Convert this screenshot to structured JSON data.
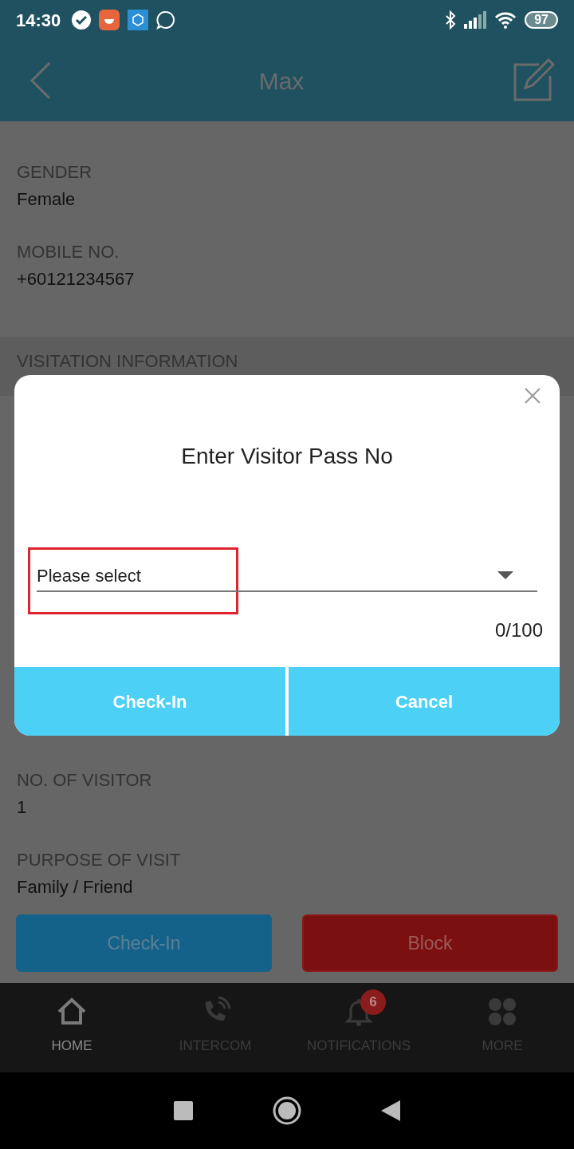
{
  "status_bar": {
    "time": "14:30",
    "battery": "97"
  },
  "header": {
    "title": "Max"
  },
  "fields": [
    {
      "label": "GENDER",
      "value": "Female"
    },
    {
      "label": "MOBILE NO.",
      "value": "+60121234567"
    }
  ],
  "section": {
    "title": "VISITATION INFORMATION"
  },
  "lower_fields": [
    {
      "label": "NO. OF VISITOR",
      "value": "1"
    },
    {
      "label": "PURPOSE OF VISIT",
      "value": "Family / Friend"
    }
  ],
  "actions": [
    {
      "label": "Check-In",
      "kind": "primary"
    },
    {
      "label": "Block",
      "kind": "danger"
    }
  ],
  "dialog": {
    "title": "Enter Visitor Pass No",
    "select": {
      "value": "Please select",
      "highlighted": true
    },
    "counter": "0/100",
    "buttons": [
      "Check-In",
      "Cancel"
    ]
  },
  "nav": [
    {
      "label": "HOME",
      "kind": "home",
      "selected": true
    },
    {
      "label": "INTERCOM",
      "kind": "phone",
      "selected": false
    },
    {
      "label": "NOTIFICATIONS",
      "kind": "bell",
      "selected": false,
      "badge": "6"
    },
    {
      "label": "MORE",
      "kind": "grid",
      "selected": false
    }
  ]
}
